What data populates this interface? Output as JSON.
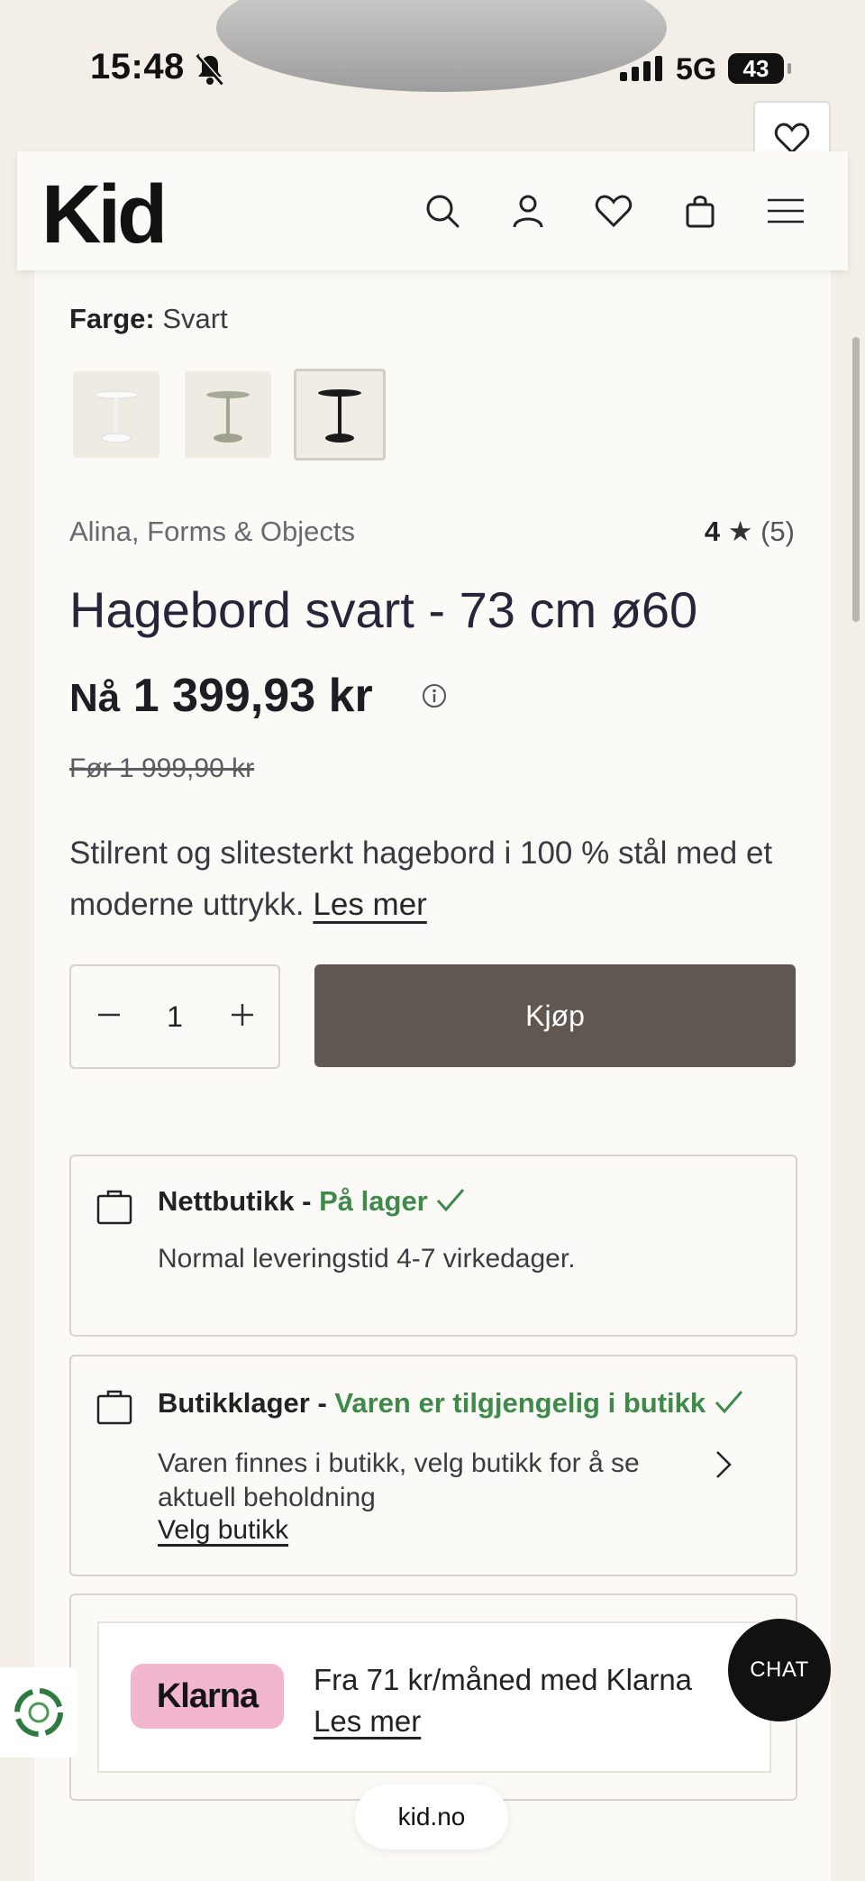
{
  "status_bar": {
    "time": "15:48",
    "network": "5G",
    "battery": "43"
  },
  "header": {
    "logo": "Kid",
    "icons": [
      "search-icon",
      "account-icon",
      "wishlist-icon",
      "cart-icon",
      "menu-icon"
    ]
  },
  "product": {
    "color_label": "Farge:",
    "color_value": "Svart",
    "swatches": [
      "Hvit",
      "Grønn",
      "Svart"
    ],
    "brand": "Alina, Forms & Objects",
    "rating_value": "4",
    "rating_star": "★",
    "rating_count": "(5)",
    "title": "Hagebord svart - 73 cm ø60",
    "price_prefix": "Nå",
    "price": "1 399,93 kr",
    "old_price": "Før 1 999,90 kr",
    "description": "Stilrent og slitesterkt hagebord i 100 % stål med et moderne uttrykk.",
    "read_more": "Les mer",
    "quantity": "1",
    "buy_label": "Kjøp"
  },
  "online_stock": {
    "label": "Nettbutikk -",
    "status": "På lager",
    "detail": "Normal leveringstid 4-7 virkedager."
  },
  "store_stock": {
    "label": "Butikklager -",
    "status": "Varen er tilgjengelig i butikk",
    "detail": "Varen finnes i butikk, velg butikk for å se aktuell beholdning",
    "link": "Velg butikk"
  },
  "klarna": {
    "logo": "Klarna",
    "text": "Fra 71 kr/måned med Klarna",
    "link": "Les mer"
  },
  "chat_label": "CHAT",
  "url": "kid.no",
  "colors": {
    "accent_green": "#3d8a4a",
    "buy_button": "#5f5750",
    "klarna_pink": "#f2b7cf"
  }
}
